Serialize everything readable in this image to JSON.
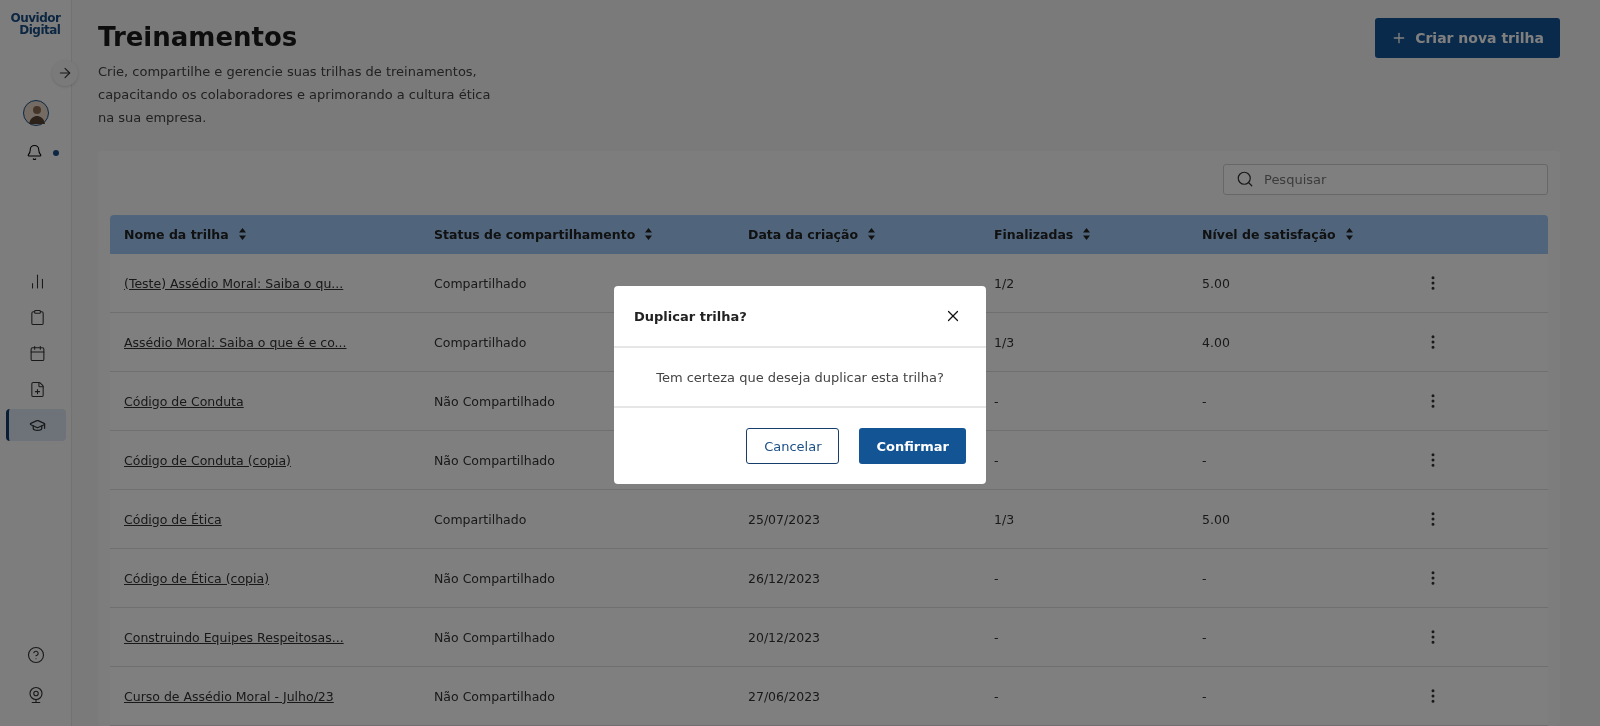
{
  "sidebar": {
    "logo": [
      "Ouvidor",
      "Digital"
    ],
    "notifications_unread": true,
    "nav_items": [
      {
        "kind": "chart",
        "selected": false
      },
      {
        "kind": "clipboard",
        "selected": false
      },
      {
        "kind": "calendar",
        "selected": false
      },
      {
        "kind": "file-plus",
        "selected": false
      },
      {
        "kind": "graduation",
        "selected": true
      }
    ],
    "bottom_items": [
      {
        "kind": "help"
      },
      {
        "kind": "webcam"
      }
    ]
  },
  "header": {
    "title": "Treinamentos",
    "description": "Crie, compartilhe e gerencie suas trilhas de treinamentos, capacitando os colaboradores e aprimorando a cultura ética na sua empresa.",
    "create_button": "Criar nova trilha"
  },
  "search": {
    "placeholder": "Pesquisar"
  },
  "table": {
    "columns": [
      "Nome da trilha",
      "Status de compartilhamento",
      "Data da criação",
      "Finalizadas",
      "Nível de satisfação"
    ],
    "rows": [
      {
        "name": "(Teste) Assédio Moral: Saiba o qu...",
        "status": "Compartilhado",
        "finalizadas": "1/2",
        "nivel": "5.00"
      },
      {
        "name": "Assédio Moral: Saiba o que é e co...",
        "status": "Compartilhado",
        "finalizadas": "1/3",
        "nivel": "4.00"
      },
      {
        "name": "Código de Conduta",
        "status": "Não Compartilhado",
        "finalizadas": "-",
        "nivel": "-"
      },
      {
        "name": "Código de Conduta (copia)",
        "status": "Não Compartilhado",
        "finalizadas": "-",
        "nivel": "-"
      },
      {
        "name": "Código de Ética",
        "status": "Compartilhado",
        "date": "25/07/2023",
        "finalizadas": "1/3",
        "nivel": "5.00"
      },
      {
        "name": "Código de Ética (copia)",
        "status": "Não Compartilhado",
        "date": "26/12/2023",
        "finalizadas": "-",
        "nivel": "-"
      },
      {
        "name": "Construindo Equipes Respeitosas...",
        "status": "Não Compartilhado",
        "date": "20/12/2023",
        "finalizadas": "-",
        "nivel": "-"
      },
      {
        "name": "Curso de Assédio Moral - Julho/23",
        "status": "Não Compartilhado",
        "date": "27/06/2023",
        "finalizadas": "-",
        "nivel": "-"
      }
    ]
  },
  "dialog": {
    "title": "Duplicar trilha?",
    "message": "Tem certeza que deseja duplicar esta trilha?",
    "cancel": "Cancelar",
    "confirm": "Confirmar"
  }
}
